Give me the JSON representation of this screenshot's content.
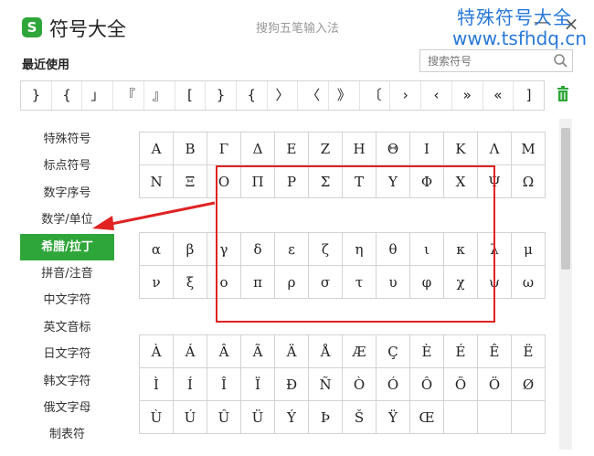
{
  "app": {
    "title": "符号大全",
    "ime_name": "搜狗五笔输入法",
    "logo_letter": "S",
    "watermark_line1": "特殊符号大全",
    "watermark_line2": "www.tsfhdq.cn",
    "close_glyph": "×",
    "minimize_glyph": "—"
  },
  "recent": {
    "label": "最近使用",
    "search_placeholder": "搜索符号",
    "items": [
      "}",
      "{",
      "」",
      "『",
      "』",
      "[",
      "}",
      "{",
      "〉",
      "〈",
      "》",
      "〔",
      "›",
      "‹",
      "»",
      "«",
      "]"
    ]
  },
  "sidebar": {
    "items": [
      "特殊符号",
      "标点符号",
      "数字序号",
      "数学/单位",
      "希腊/拉丁",
      "拼音/注音",
      "中文字符",
      "英文音标",
      "日文字符",
      "韩文字符",
      "俄文字母",
      "制表符"
    ],
    "active_index": 4
  },
  "grid": {
    "greek_upper": [
      [
        "Α",
        "Β",
        "Γ",
        "Δ",
        "Ε",
        "Ζ",
        "Η",
        "Θ",
        "Ι",
        "Κ",
        "Λ",
        "Μ"
      ],
      [
        "Ν",
        "Ξ",
        "Ο",
        "Π",
        "Ρ",
        "Σ",
        "Τ",
        "Υ",
        "Φ",
        "Χ",
        "Ψ",
        "Ω"
      ]
    ],
    "greek_lower": [
      [
        "α",
        "β",
        "γ",
        "δ",
        "ε",
        "ζ",
        "η",
        "θ",
        "ι",
        "κ",
        "λ",
        "μ"
      ],
      [
        "ν",
        "ξ",
        "ο",
        "π",
        "ρ",
        "σ",
        "τ",
        "υ",
        "φ",
        "χ",
        "ψ",
        "ω"
      ]
    ],
    "latin": [
      [
        "À",
        "Á",
        "Â",
        "Ã",
        "Ä",
        "Å",
        "Æ",
        "Ç",
        "È",
        "É",
        "Ê",
        "Ë"
      ],
      [
        "Ì",
        "Í",
        "Î",
        "Ï",
        "Ð",
        "Ñ",
        "Ò",
        "Ó",
        "Ô",
        "Õ",
        "Ö",
        "Ø"
      ],
      [
        "Ù",
        "Ú",
        "Û",
        "Ü",
        "Ý",
        "Þ",
        "Š",
        "Ÿ",
        "Œ",
        "",
        "",
        ""
      ]
    ]
  },
  "colors": {
    "accent": "#2fa63a",
    "watermark": "#2878d8",
    "annotation": "#e02222"
  }
}
